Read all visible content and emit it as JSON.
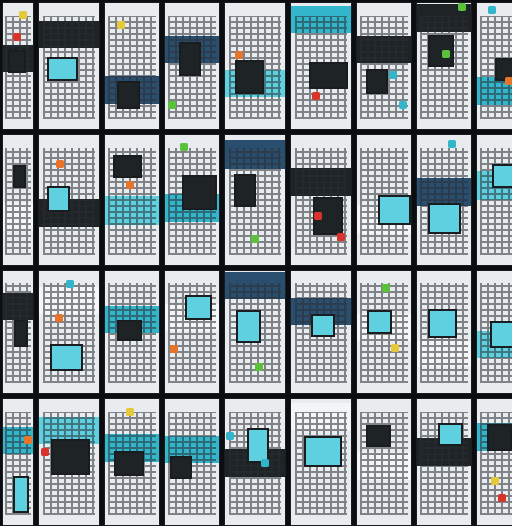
{
  "mosaic": {
    "columns": 9,
    "rows": 4,
    "palette": {
      "background": "#0b0d10",
      "teal": "#33b6cc",
      "cyan": "#5fd0e0",
      "dark": "#1e2326",
      "light": "#e9ecee",
      "accents": [
        "#e8732a",
        "#59c23a",
        "#d9342b",
        "#e6c93a"
      ]
    }
  }
}
